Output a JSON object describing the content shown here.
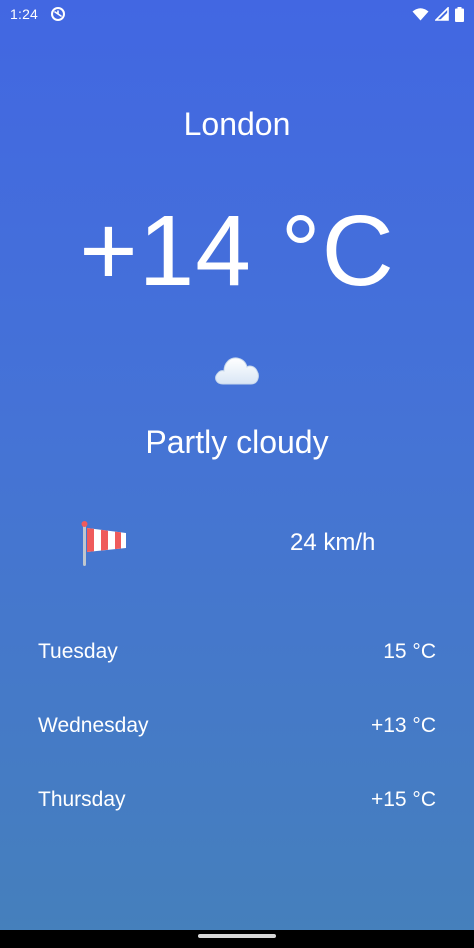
{
  "status_bar": {
    "time": "1:24",
    "icons": [
      "data-saver-icon",
      "wifi-icon",
      "cell-signal-icon",
      "battery-icon"
    ]
  },
  "weather": {
    "city": "London",
    "temperature": "+14 °C",
    "condition": "Partly cloudy",
    "condition_icon": "cloud-icon",
    "wind_icon": "windsock-icon",
    "wind_speed": "24 km/h"
  },
  "forecast": [
    {
      "day": "Tuesday",
      "temp": "15 °C"
    },
    {
      "day": "Wednesday",
      "temp": "+13 °C"
    },
    {
      "day": "Thursday",
      "temp": "+15 °C"
    }
  ],
  "colors": {
    "background_top": "#4267e2",
    "background_bottom": "#4580bb",
    "text": "#ffffff",
    "windsock_red": "#ef5b5b"
  }
}
